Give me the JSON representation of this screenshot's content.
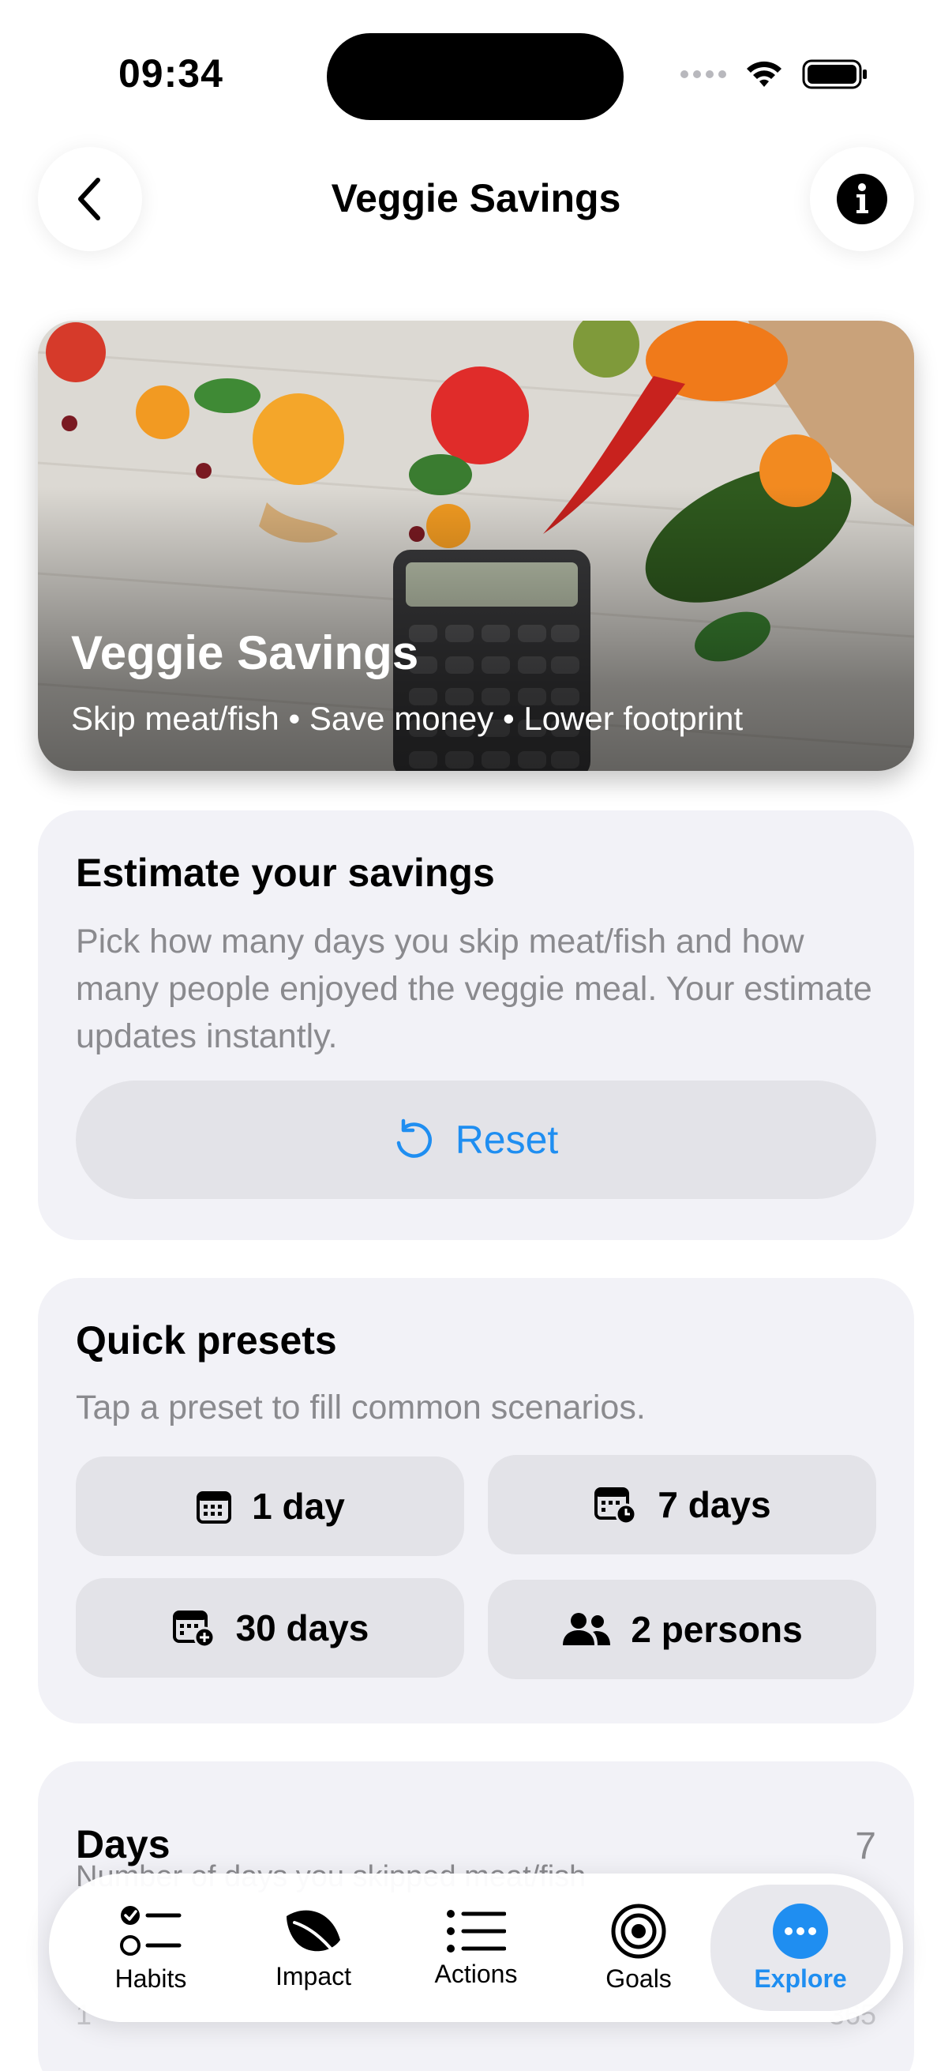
{
  "status": {
    "time": "09:34"
  },
  "nav": {
    "title": "Veggie Savings"
  },
  "hero": {
    "title": "Veggie Savings",
    "subtitle": "Skip meat/fish • Save money • Lower footprint"
  },
  "estimate": {
    "title": "Estimate your savings",
    "description": "Pick how many days you skip meat/fish and how many people enjoyed the veggie meal. Your estimate updates instantly.",
    "reset_label": "Reset"
  },
  "presets": {
    "title": "Quick presets",
    "description": "Tap a preset to fill common scenarios.",
    "items": [
      {
        "label": "1 day",
        "icon": "calendar-icon"
      },
      {
        "label": "7 days",
        "icon": "calendar-clock-icon"
      },
      {
        "label": "30 days",
        "icon": "calendar-plus-icon"
      },
      {
        "label": "2 persons",
        "icon": "people-icon"
      }
    ]
  },
  "days": {
    "title": "Days",
    "description": "Number of days you skipped meat/fish",
    "value": "7",
    "slider_min": "1",
    "slider_max": "365"
  },
  "tabs": [
    {
      "label": "Habits",
      "icon": "checklist-icon"
    },
    {
      "label": "Impact",
      "icon": "leaf-icon"
    },
    {
      "label": "Actions",
      "icon": "list-icon"
    },
    {
      "label": "Goals",
      "icon": "target-icon"
    },
    {
      "label": "Explore",
      "icon": "more-icon",
      "active": true
    }
  ],
  "colors": {
    "accent": "#1f8ef1",
    "card": "#f2f2f7",
    "secondary_text": "#8a8a8e"
  }
}
